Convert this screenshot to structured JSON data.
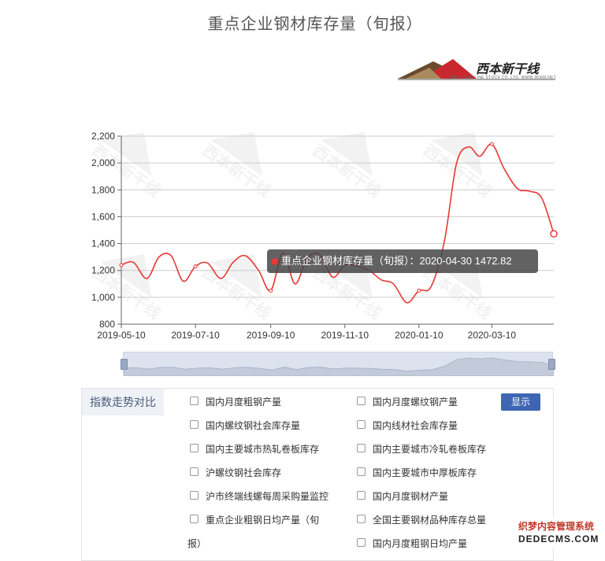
{
  "chart_data": {
    "type": "line",
    "title": "重点企业钢材库存量（旬报）",
    "xlabel": "",
    "ylabel": "",
    "ylim": [
      800,
      2200
    ],
    "yticks": [
      800,
      1000,
      1200,
      1400,
      1600,
      1800,
      2000,
      2200
    ],
    "ytick_labels": [
      "800",
      "1,000",
      "1,200",
      "1,400",
      "1,600",
      "1,800",
      "2,000",
      "2,200"
    ],
    "xtick_labels": [
      "2019-05-10",
      "2019-07-10",
      "2019-09-10",
      "2019-11-10",
      "2020-01-10",
      "2020-03-10"
    ],
    "grid": true,
    "series": [
      {
        "name": "重点企业钢材库存量（旬报）",
        "color": "#e53935",
        "x": [
          "2019-05-10",
          "2019-05-20",
          "2019-05-31",
          "2019-06-10",
          "2019-06-20",
          "2019-06-30",
          "2019-07-10",
          "2019-07-20",
          "2019-07-31",
          "2019-08-10",
          "2019-08-20",
          "2019-08-31",
          "2019-09-10",
          "2019-09-20",
          "2019-09-30",
          "2019-10-10",
          "2019-10-20",
          "2019-10-31",
          "2019-11-10",
          "2019-11-20",
          "2019-11-30",
          "2019-12-10",
          "2019-12-20",
          "2019-12-31",
          "2020-01-10",
          "2020-01-20",
          "2020-01-31",
          "2020-02-10",
          "2020-02-20",
          "2020-02-29",
          "2020-03-10",
          "2020-03-20",
          "2020-03-31",
          "2020-04-10",
          "2020-04-20",
          "2020-04-30"
        ],
        "values": [
          1240,
          1260,
          1140,
          1300,
          1310,
          1120,
          1230,
          1255,
          1140,
          1260,
          1310,
          1200,
          1050,
          1330,
          1100,
          1290,
          1320,
          1150,
          1240,
          1230,
          1200,
          1130,
          1100,
          960,
          1050,
          1080,
          1420,
          2000,
          2120,
          2050,
          2140,
          1960,
          1810,
          1790,
          1740,
          1472.82
        ]
      }
    ]
  },
  "tooltip": {
    "text": "重点企业钢材库存量（旬报）：2020-04-30 1472.82"
  },
  "logo": {
    "text": "西本新干线",
    "subtext": "XIBEN NEW LINE STOCK CO.,LTD.   WWW.96369.NET"
  },
  "panel": {
    "label": "指数走势对比",
    "show_button": "显示",
    "options": [
      "国内月度粗钢产量",
      "国内月度螺纹钢产量",
      "国内螺纹钢社会库存量",
      "国内线材社会库存量",
      "国内主要城市热轧卷板库存",
      "国内主要城市冷轧卷板库存",
      "沪螺纹钢社会库存",
      "国内主要城市中厚板库存",
      "沪市终端线螺每周采购量监控",
      "国内月度钢材产量",
      "重点企业粗钢日均产量（旬",
      "全国主要钢材品种库存总量",
      "报）",
      "国内月度粗钢日均产量"
    ]
  },
  "footer": {
    "line1": "织梦内容管理系统",
    "line2": "DEDECMS.COM"
  },
  "colors": {
    "line": "#e53935",
    "grid": "#cccccc",
    "button": "#3f66b3",
    "panel_label_bg": "#eef1f6"
  }
}
